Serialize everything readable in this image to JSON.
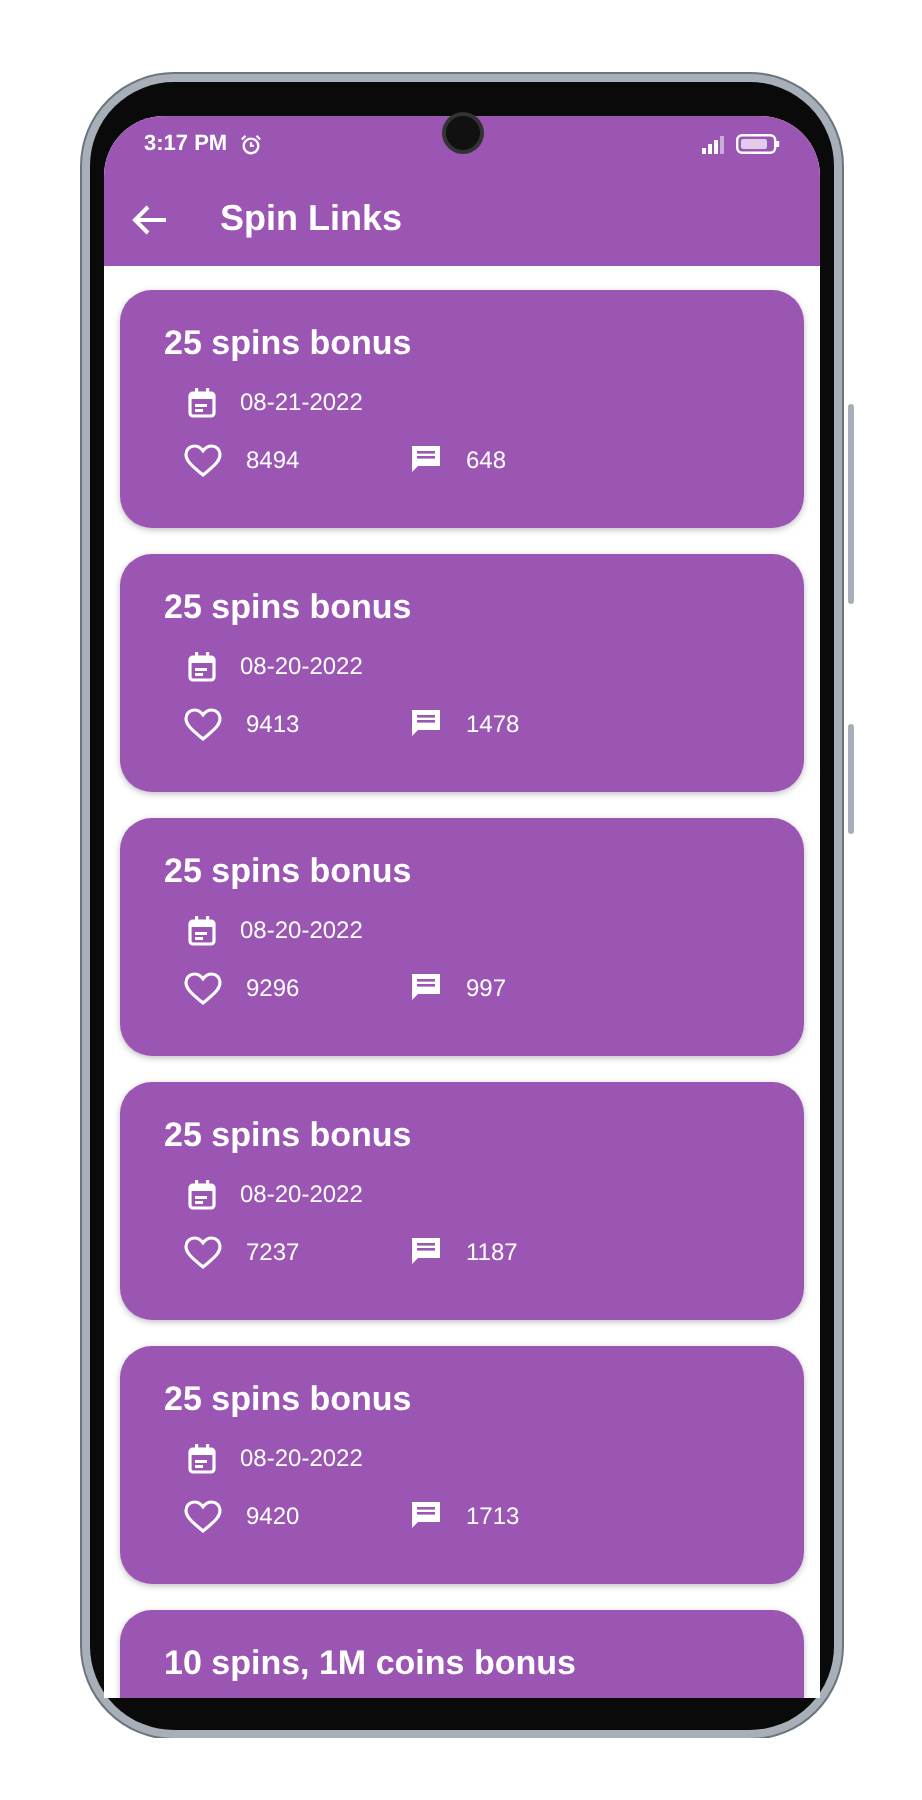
{
  "status_bar": {
    "time": "3:17 PM"
  },
  "app_bar": {
    "title": "Spin Links"
  },
  "posts": [
    {
      "title": "25 spins bonus",
      "date": "08-21-2022",
      "likes": "8494",
      "comments": "648"
    },
    {
      "title": "25 spins bonus",
      "date": "08-20-2022",
      "likes": "9413",
      "comments": "1478"
    },
    {
      "title": "25 spins bonus",
      "date": "08-20-2022",
      "likes": "9296",
      "comments": "997"
    },
    {
      "title": "25 spins bonus",
      "date": "08-20-2022",
      "likes": "7237",
      "comments": "1187"
    },
    {
      "title": "25 spins bonus",
      "date": "08-20-2022",
      "likes": "9420",
      "comments": "1713"
    },
    {
      "title": "10 spins, 1M coins bonus"
    }
  ]
}
